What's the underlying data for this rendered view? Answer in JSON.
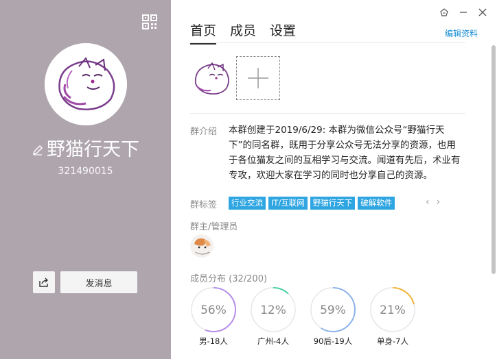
{
  "left": {
    "group_name": "野猫行天下",
    "group_id": "321490015",
    "send_message_label": "发消息",
    "icons": [
      "qr-code-icon",
      "edit-icon",
      "share-icon"
    ]
  },
  "header": {
    "tabs": [
      {
        "label": "首页",
        "active": true
      },
      {
        "label": "成员",
        "active": false
      },
      {
        "label": "设置",
        "active": false
      }
    ],
    "edit_profile": "编辑资料",
    "window_controls": [
      "skin-icon",
      "minimize-icon",
      "close-icon"
    ]
  },
  "intro": {
    "label": "群介绍",
    "text": "本群创建于2019/6/29: 本群为微信公众号“野猫行天下”的同名群，既用于分享公众号无法分享的资源，也用于各位猫友之间的互相学习与交流。闻道有先后，术业有专攻，欢迎大家在学习的同时也分享自己的资源。"
  },
  "tags": {
    "label": "群标签",
    "items": [
      "行业交流",
      "IT/互联网",
      "野猫行天下",
      "破解软件"
    ],
    "prev": "‹",
    "next": "›"
  },
  "admins": {
    "label": "群主/管理员"
  },
  "distribution": {
    "label": "成员分布",
    "count": "(32/200)",
    "rings": [
      {
        "percent_text": "56%",
        "fraction": 0.56,
        "caption": "男-18人",
        "color": "#b58ee8"
      },
      {
        "percent_text": "12%",
        "fraction": 0.12,
        "caption": "广州-4人",
        "color": "#46d0a4"
      },
      {
        "percent_text": "59%",
        "fraction": 0.59,
        "caption": "90后-19人",
        "color": "#8cb3ea"
      },
      {
        "percent_text": "21%",
        "fraction": 0.21,
        "caption": "单身-7人",
        "color": "#f2b43a"
      }
    ]
  }
}
